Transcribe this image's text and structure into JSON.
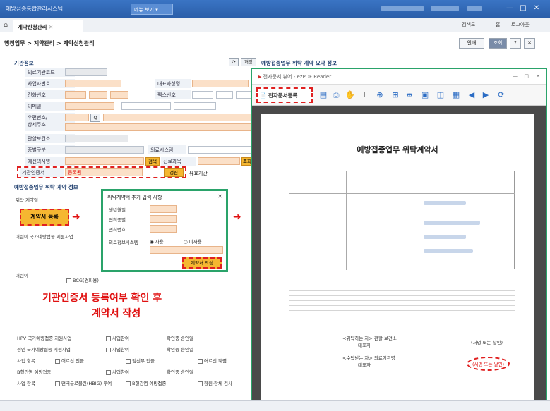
{
  "window": {
    "title": "예방접종통합관리시스템",
    "menu_label": "메뉴 보기",
    "controls": [
      "—",
      "□",
      "✕"
    ]
  },
  "tabbar": {
    "tab_label": "계약신청관리",
    "right_links": [
      "검색도",
      "홈",
      "로그아웃"
    ]
  },
  "breadcrumb": {
    "text": "행정업무 > 계약관리 > 계약신청관리",
    "toolbar": [
      "인쇄",
      "조회",
      "?",
      "✕"
    ]
  },
  "sections": {
    "institution": "기관정보",
    "summary": "예방접종업무 위탁 계약 요약 정보",
    "contract": "예방접종업무 위탁 계약 정보"
  },
  "buttons": {
    "inquiry": "조회",
    "save": "저장",
    "search": "검색",
    "lookup": "조회",
    "renew": "갱신",
    "contract_reg": "계약서 등록",
    "contract_write": "계약서 작성",
    "cert_register": "전자문서등록"
  },
  "labels": {
    "row1": "의료기관코드",
    "row2": "사업자번호",
    "row2b": "대표자성명",
    "row3": "전화번호",
    "row3b": "팩스번호",
    "row4": "이메일",
    "row5": "우편번호/\n상세주소",
    "row6": "관할보건소",
    "row7": "종별구분",
    "row7b": "의료시스템",
    "row8": "예진의사명",
    "row8b": "진료과목",
    "row9": "기관인증서",
    "row9_value": "등록됨",
    "row9b": "유효기간",
    "item_contract": "위탁 계약일",
    "item_nip": "어린이 국가예방접종 지원사업"
  },
  "popup": {
    "title": "위탁계약서 추가 입력 사항",
    "fields": [
      "생년월일",
      "면허종별",
      "면허번호",
      "의료정보시스템"
    ],
    "radio1": "사용",
    "radio2": "미사용"
  },
  "annotation": {
    "line1": "기관인증서 등록여부 확인 후",
    "line2": "계약서 작성"
  },
  "lower": {
    "hpv": "HPV 국가예방접종 지원사업",
    "adult": "성인 국가예방접종 지원사업",
    "item_a": "사업참여",
    "item_b": "확인중 승인일",
    "opt1": "어르신 인플",
    "opt2": "임신부 인플",
    "opt3": "어르신 폐렴",
    "bcg": "BCG(경피용)",
    "kids": "어린이",
    "adults": "성인",
    "extra_label": "사업 항목",
    "pay": "면역글로불린(HBIG) 투여",
    "check": "B형간염 예방접종",
    "check2": "항원·항체 검사"
  },
  "viewer": {
    "title": "전자문서 뷰어 - ezPDF Reader",
    "doc_title": "예방접종업무 위탁계약서",
    "sign_label": "(서명 또는 날인)",
    "sign_label2": "(서명 또는 날인)",
    "footer_labels": [
      "<위탁하는 자> 관할 보건소",
      "대표자",
      "<수탁받는 자> 의료기관명",
      "대표자"
    ]
  }
}
